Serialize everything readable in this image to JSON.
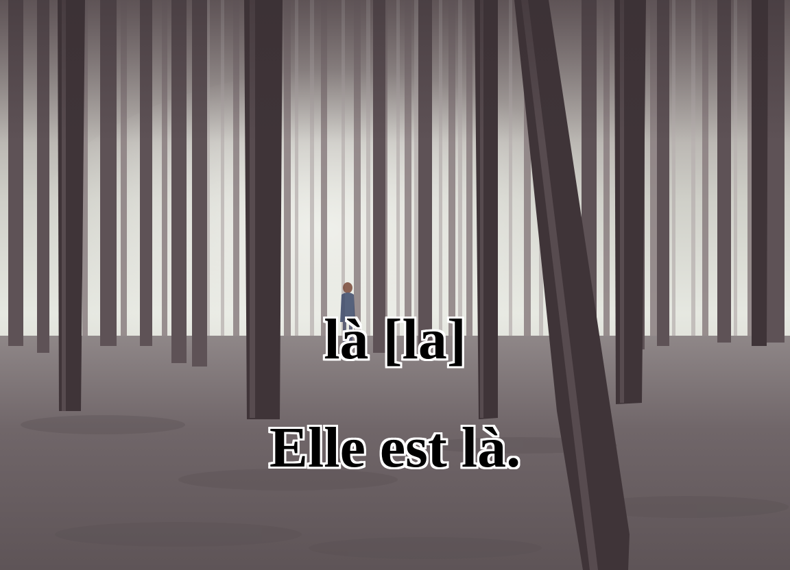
{
  "caption": {
    "word": "là [la]",
    "sentence": "Elle est là."
  },
  "colors": {
    "fog": "#e4e6df",
    "ground": "#6d6366",
    "trunk_dark": "#3a3034",
    "trunk_mid": "#5e5256",
    "text_fill": "#000000",
    "text_outline": "#ffffff"
  }
}
